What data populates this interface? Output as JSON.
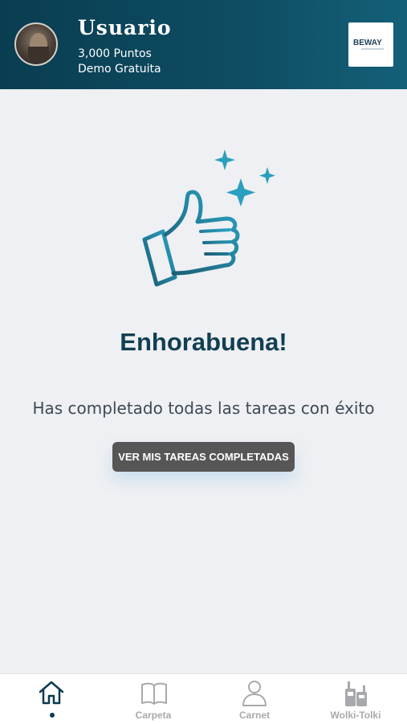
{
  "header": {
    "username": "Usuario",
    "points": "3,000 Puntos",
    "plan": "Demo Gratuita",
    "logo_text": "BEWAY"
  },
  "main": {
    "title": "Enhorabuena!",
    "message": "Has completado todas las tareas con éxito",
    "button_label": "VER MIS TAREAS COMPLETADAS"
  },
  "tabbar": {
    "items": [
      {
        "label": "",
        "icon": "home-icon",
        "active": true
      },
      {
        "label": "Carpeta",
        "icon": "book-icon",
        "active": false
      },
      {
        "label": "Carnet",
        "icon": "user-icon",
        "active": false
      },
      {
        "label": "Wolki-Tolki",
        "icon": "walkie-talkie-icon",
        "active": false
      }
    ]
  },
  "colors": {
    "header_dark": "#0a3d51",
    "accent": "#2a9fbf",
    "title": "#123f52",
    "button": "#565656",
    "tab_inactive": "#a7a9ac",
    "background": "#eef0f3"
  }
}
